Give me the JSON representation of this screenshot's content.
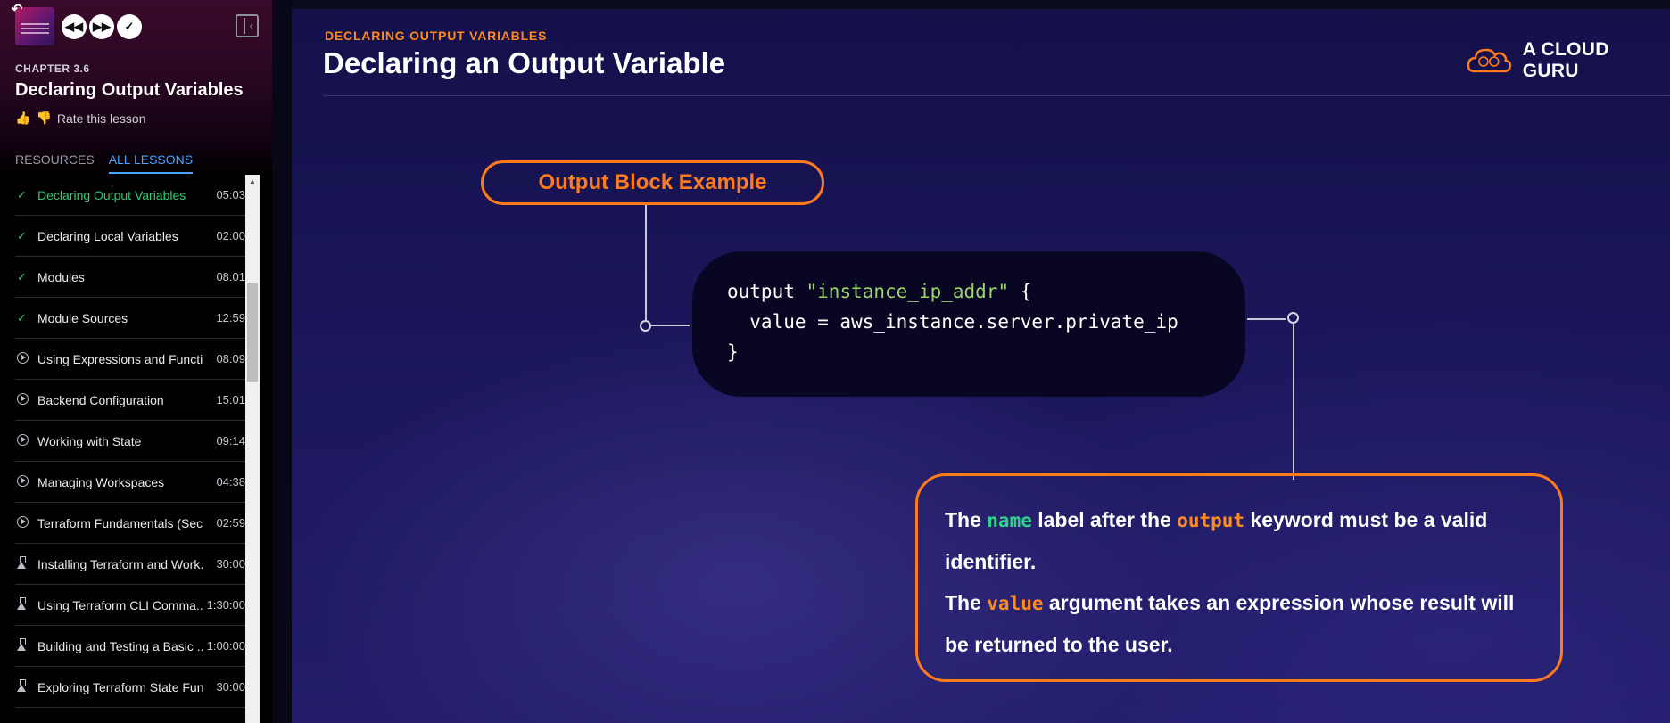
{
  "sidebar": {
    "chapter": "CHAPTER 3.6",
    "lesson_title": "Declaring Output Variables",
    "rate_label": "Rate this lesson",
    "tabs": [
      {
        "label": "RESOURCES"
      },
      {
        "label": "ALL LESSONS"
      }
    ],
    "lessons": [
      {
        "name": "Declaring Output Variables",
        "time": "05:03",
        "icon": "check-icon"
      },
      {
        "name": "Declaring Local Variables",
        "time": "02:00",
        "icon": "check-icon"
      },
      {
        "name": "Modules",
        "time": "08:01",
        "icon": "check-icon"
      },
      {
        "name": "Module Sources",
        "time": "12:59",
        "icon": "check-icon"
      },
      {
        "name": "Using Expressions and Functi...",
        "time": "08:09",
        "icon": "play-icon"
      },
      {
        "name": "Backend Configuration",
        "time": "15:01",
        "icon": "play-icon"
      },
      {
        "name": "Working with State",
        "time": "09:14",
        "icon": "play-icon"
      },
      {
        "name": "Managing Workspaces",
        "time": "04:38",
        "icon": "play-icon"
      },
      {
        "name": "Terraform Fundamentals (Sec...",
        "time": "02:59",
        "icon": "play-icon"
      },
      {
        "name": "Installing Terraform and Work...",
        "time": "30:00",
        "icon": "lab-flask-icon"
      },
      {
        "name": "Using Terraform CLI Comma...",
        "time": "1:30:00",
        "icon": "lab-flask-icon"
      },
      {
        "name": "Building and Testing a Basic ...",
        "time": "1:00:00",
        "icon": "lab-flask-icon"
      },
      {
        "name": "Exploring Terraform State Fun...",
        "time": "30:00",
        "icon": "lab-flask-icon"
      }
    ]
  },
  "slide": {
    "subtitle": "DECLARING OUTPUT VARIABLES",
    "title": "Declaring an Output Variable",
    "brand": "A CLOUD GURU",
    "callout_label": "Output Block Example",
    "code": {
      "line1_kw": "output ",
      "line1_str": "\"instance_ip_addr\"",
      "line1_end": " {",
      "line2": "  value = aws_instance.server.private_ip",
      "line3": "}"
    },
    "desc": {
      "p1_a": "The ",
      "p1_name": "name",
      "p1_b": " label after the ",
      "p1_output": "output",
      "p1_c": " keyword must be a valid identifier.",
      "p2_a": "The ",
      "p2_value": "value",
      "p2_b": " argument takes an expression whose result will be returned to the user."
    }
  },
  "colors": {
    "accent_orange": "#ff7a1a",
    "keyword_green": "#2fd08a",
    "completed_green": "#2ecc71",
    "tab_active_blue": "#4aa3ff"
  }
}
